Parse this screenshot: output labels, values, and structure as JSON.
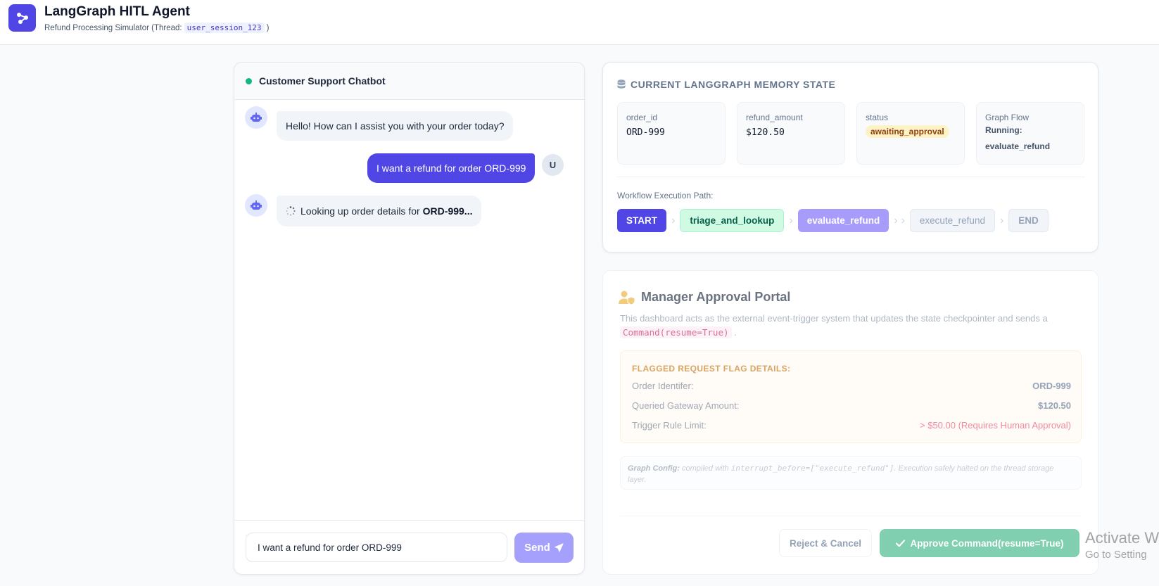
{
  "header": {
    "title": "LangGraph HITL Agent",
    "subtitle_prefix": "Refund Processing Simulator (Thread:",
    "thread_id": "user_session_123",
    "subtitle_suffix": ")"
  },
  "chat": {
    "title": "Customer Support Chatbot",
    "messages": [
      {
        "role": "bot",
        "text": "Hello! How can I assist you with your order today?"
      },
      {
        "role": "user",
        "text": "I want a refund for order ORD-999",
        "avatar": "U"
      },
      {
        "role": "bot",
        "text": "Looking up order details for",
        "bold": "ORD-999...",
        "loading": true
      }
    ],
    "input_value": "I want a refund for order ORD-999",
    "send_label": "Send"
  },
  "memory": {
    "title": "CURRENT LANGGRAPH MEMORY STATE",
    "fields": [
      {
        "label": "order_id",
        "value": "ORD-999"
      },
      {
        "label": "refund_amount",
        "value": "$120.50"
      },
      {
        "label": "status",
        "value": "awaiting_approval"
      },
      {
        "label": "Graph Flow",
        "line1": "Running:",
        "line2": "evaluate_refund"
      }
    ],
    "path_label": "Workflow Execution Path:",
    "steps": [
      "START",
      "triage_and_lookup",
      "evaluate_refund",
      "execute_refund",
      "END"
    ]
  },
  "portal": {
    "title": "Manager Approval Portal",
    "desc": "This dashboard acts as the external event-trigger system that updates the state checkpointer and sends a",
    "command": "Command(resume=True)",
    "desc_end": ".",
    "flag_title": "FLAGGED REQUEST FLAG DETAILS:",
    "rows": [
      {
        "key": "Order Identifer:",
        "value": "ORD-999"
      },
      {
        "key": "Queried Gateway Amount:",
        "value": "$120.50"
      },
      {
        "key": "Trigger Rule Limit:",
        "value": "> $50.00 (Requires Human Approval)"
      }
    ],
    "config_label": "Graph Config:",
    "config_text": "compiled with",
    "config_code": "interrupt_before=[\"execute_refund\"]",
    "config_rest": ". Execution safely halted on the thread storage layer.",
    "reject_label": "Reject & Cancel",
    "approve_label": "Approve Command(resume=True)"
  },
  "watermark": {
    "line1": "Activate W",
    "line2": "Go to Setting"
  },
  "colors": {
    "primary": "#4f46e5",
    "success": "#10b981",
    "approve": "#7fcfb0",
    "warning_badge": "#fef3c7"
  }
}
